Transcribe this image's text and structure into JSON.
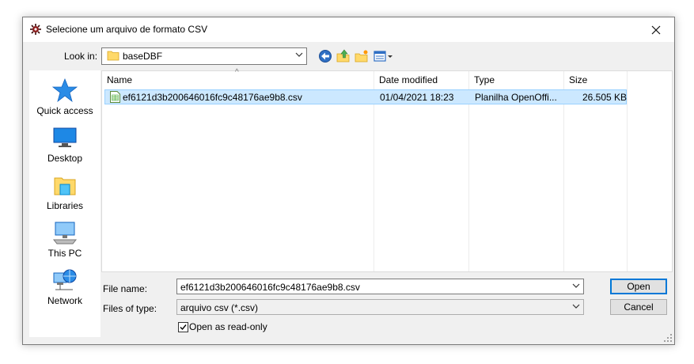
{
  "dialog": {
    "title": "Selecione um arquivo de formato CSV",
    "icon": "app-gear-icon"
  },
  "lookin": {
    "label": "Look in:",
    "value": "baseDBF"
  },
  "toolbar": {
    "icons": [
      "back-arrow-icon",
      "up-folder-icon",
      "new-folder-icon",
      "view-menu-icon"
    ]
  },
  "places": [
    {
      "label": "Quick access",
      "icon": "star-icon"
    },
    {
      "label": "Desktop",
      "icon": "desktop-icon"
    },
    {
      "label": "Libraries",
      "icon": "libraries-icon"
    },
    {
      "label": "This PC",
      "icon": "computer-icon"
    },
    {
      "label": "Network",
      "icon": "network-icon"
    }
  ],
  "filelist": {
    "columns": [
      "Name",
      "Date modified",
      "Type",
      "Size"
    ],
    "sort_indicator": "^",
    "rows": [
      {
        "name": "ef6121d3b200646016fc9c48176ae9b8.csv",
        "date": "01/04/2021 18:23",
        "type": "Planilha OpenOffi...",
        "size": "26.505 KB",
        "selected": true
      }
    ]
  },
  "form": {
    "filename_label": "File name:",
    "filename_value": "ef6121d3b200646016fc9c48176ae9b8.csv",
    "filetype_label": "Files of type:",
    "filetype_value": "arquivo csv (*.csv)",
    "readonly_label": "Open as read-only",
    "readonly_checked": true
  },
  "buttons": {
    "open": "Open",
    "cancel": "Cancel"
  },
  "colors": {
    "selection_bg": "#cce8ff",
    "selection_border": "#99d1ff",
    "accent": "#0078d7"
  }
}
